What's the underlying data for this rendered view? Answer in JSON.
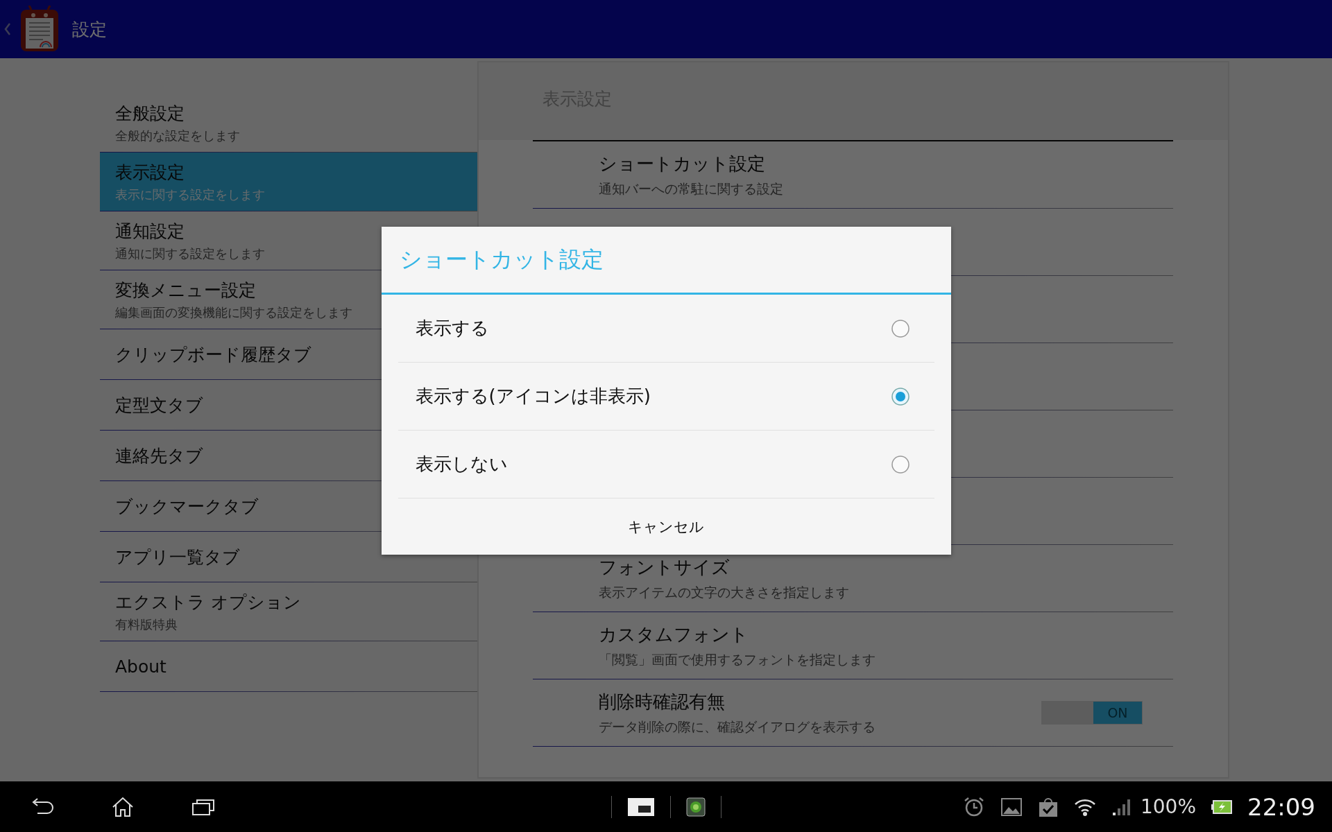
{
  "app_bar": {
    "title": "設定"
  },
  "sidebar": {
    "items": [
      {
        "title": "全般設定",
        "subtitle": "全般的な設定をします",
        "selected": false
      },
      {
        "title": "表示設定",
        "subtitle": "表示に関する設定をします",
        "selected": true
      },
      {
        "title": "通知設定",
        "subtitle": "通知に関する設定をします",
        "selected": false
      },
      {
        "title": "変換メニュー設定",
        "subtitle": "編集画面の変換機能に関する設定をします",
        "selected": false
      },
      {
        "title": "クリップボード履歴タブ",
        "selected": false
      },
      {
        "title": "定型文タブ",
        "selected": false
      },
      {
        "title": "連絡先タブ",
        "selected": false
      },
      {
        "title": "ブックマークタブ",
        "selected": false
      },
      {
        "title": "アプリ一覧タブ",
        "selected": false
      },
      {
        "title": "エクストラ オプション",
        "subtitle": "有料版特典",
        "selected": false
      },
      {
        "title": "About",
        "selected": false
      }
    ]
  },
  "panel": {
    "title": "表示設定",
    "items": [
      {
        "kind": "setting",
        "title": "ショートカット設定",
        "subtitle": "通知バーへの常駐に関する設定"
      },
      {
        "kind": "setting",
        "title": "フォントサイズ",
        "subtitle": "表示アイテムの文字の大きさを指定します"
      },
      {
        "kind": "setting",
        "title": "カスタムフォント",
        "subtitle": "「閲覧」画面で使用するフォントを指定します"
      },
      {
        "kind": "toggle",
        "title": "削除時確認有無",
        "subtitle": "データ削除の際に、確認ダイアログを表示する",
        "on": true,
        "toggle_label": "ON"
      }
    ]
  },
  "dialog": {
    "title": "ショートカット設定",
    "options": [
      {
        "label": "表示する",
        "selected": false
      },
      {
        "label": "表示する(アイコンは非表示)",
        "selected": true
      },
      {
        "label": "表示しない",
        "selected": false
      }
    ],
    "cancel": "キャンセル"
  },
  "navigation_bar": {
    "battery": "100%",
    "time": "22:09"
  }
}
